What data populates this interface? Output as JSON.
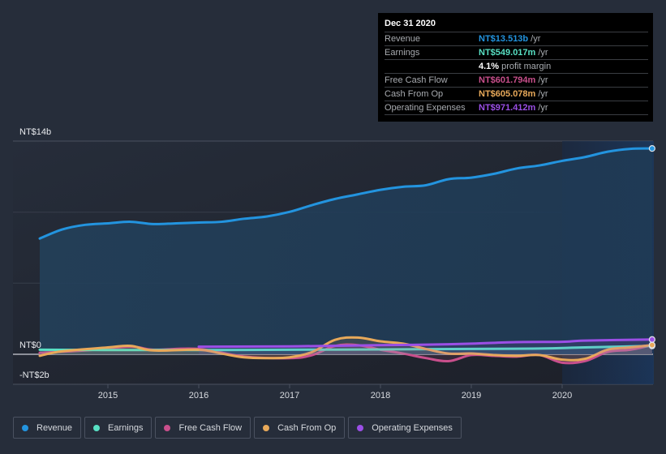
{
  "chart_data": {
    "type": "line",
    "title": "",
    "xlabel": "",
    "ylabel": "",
    "currency_prefix": "NT$",
    "y_ticks": [
      {
        "value": 14,
        "label": "NT$14b"
      },
      {
        "value": 0,
        "label": "NT$0"
      },
      {
        "value": -2,
        "label": "-NT$2b"
      }
    ],
    "ylim": [
      -2,
      14
    ],
    "xlim": [
      2014.25,
      2020.99
    ],
    "x_ticks": [
      {
        "value": 2015,
        "label": "2015"
      },
      {
        "value": 2016,
        "label": "2016"
      },
      {
        "value": 2017,
        "label": "2017"
      },
      {
        "value": 2018,
        "label": "2018"
      },
      {
        "value": 2019,
        "label": "2019"
      },
      {
        "value": 2020,
        "label": "2020"
      }
    ],
    "highlight_range": [
      2020.0,
      2020.99
    ],
    "units": "NT$ billions",
    "series": [
      {
        "name": "Revenue",
        "color": "#2394df",
        "filled": true,
        "x": [
          2014.25,
          2014.5,
          2014.75,
          2015.0,
          2015.25,
          2015.5,
          2015.75,
          2016.0,
          2016.25,
          2016.5,
          2016.75,
          2017.0,
          2017.25,
          2017.5,
          2017.75,
          2018.0,
          2018.25,
          2018.5,
          2018.75,
          2019.0,
          2019.25,
          2019.5,
          2019.75,
          2020.0,
          2020.25,
          2020.5,
          2020.75,
          2020.99
        ],
        "values": [
          7.6,
          8.2,
          8.5,
          8.6,
          8.7,
          8.55,
          8.6,
          8.65,
          8.7,
          8.9,
          9.05,
          9.35,
          9.8,
          10.2,
          10.5,
          10.8,
          11.0,
          11.1,
          11.5,
          11.6,
          11.85,
          12.2,
          12.4,
          12.7,
          12.95,
          13.3,
          13.49,
          13.513
        ]
      },
      {
        "name": "Earnings",
        "color": "#58e0c4",
        "x": [
          2014.25,
          2015.0,
          2016.0,
          2017.0,
          2018.0,
          2019.0,
          2019.75,
          2020.25,
          2020.99
        ],
        "values": [
          0.3,
          0.28,
          0.28,
          0.3,
          0.32,
          0.35,
          0.38,
          0.45,
          0.549
        ]
      },
      {
        "name": "Free Cash Flow",
        "color": "#c94f8c",
        "x": [
          2014.25,
          2014.75,
          2015.25,
          2015.5,
          2016.0,
          2016.5,
          2017.0,
          2017.25,
          2017.5,
          2017.75,
          2018.0,
          2018.25,
          2018.5,
          2018.75,
          2019.0,
          2019.25,
          2019.5,
          2019.75,
          2020.0,
          2020.25,
          2020.5,
          2020.75,
          2020.99
        ],
        "values": [
          0.1,
          0.25,
          0.5,
          0.3,
          0.35,
          -0.15,
          -0.25,
          -0.05,
          0.55,
          0.6,
          0.3,
          0.05,
          -0.25,
          -0.45,
          -0.05,
          -0.1,
          -0.15,
          -0.05,
          -0.55,
          -0.45,
          0.15,
          0.3,
          0.6018
        ]
      },
      {
        "name": "Cash From Op",
        "color": "#e8a95a",
        "x": [
          2014.25,
          2014.5,
          2015.0,
          2015.25,
          2015.5,
          2016.0,
          2016.25,
          2016.5,
          2016.75,
          2017.0,
          2017.25,
          2017.5,
          2017.75,
          2018.0,
          2018.25,
          2018.5,
          2018.75,
          2019.0,
          2019.25,
          2019.5,
          2019.75,
          2020.0,
          2020.25,
          2020.5,
          2020.75,
          2020.99
        ],
        "values": [
          -0.1,
          0.2,
          0.45,
          0.55,
          0.25,
          0.3,
          0.05,
          -0.2,
          -0.25,
          -0.2,
          0.15,
          0.95,
          1.1,
          0.85,
          0.7,
          0.35,
          0.05,
          0.05,
          -0.05,
          -0.1,
          -0.05,
          -0.35,
          -0.3,
          0.3,
          0.45,
          0.6051
        ]
      },
      {
        "name": "Operating Expenses",
        "color": "#9b4fe6",
        "x": [
          2016.0,
          2017.0,
          2018.0,
          2018.5,
          2019.0,
          2019.5,
          2020.0,
          2020.25,
          2020.99
        ],
        "values": [
          0.5,
          0.52,
          0.6,
          0.63,
          0.7,
          0.8,
          0.82,
          0.9,
          0.9714
        ]
      }
    ]
  },
  "tooltip": {
    "date": "Dec 31 2020",
    "rows": [
      {
        "label": "Revenue",
        "value": "NT$13.513b",
        "unit": "/yr",
        "color": "#2394df"
      },
      {
        "label": "Earnings",
        "value": "NT$549.017m",
        "unit": "/yr",
        "color": "#58e0c4"
      },
      {
        "label": "",
        "value": "4.1%",
        "unit": "profit margin",
        "color": "#ffffff"
      },
      {
        "label": "Free Cash Flow",
        "value": "NT$601.794m",
        "unit": "/yr",
        "color": "#c94f8c"
      },
      {
        "label": "Cash From Op",
        "value": "NT$605.078m",
        "unit": "/yr",
        "color": "#e8a95a"
      },
      {
        "label": "Operating Expenses",
        "value": "NT$971.412m",
        "unit": "/yr",
        "color": "#9b4fe6"
      }
    ]
  },
  "legend": [
    {
      "label": "Revenue",
      "color": "#2394df"
    },
    {
      "label": "Earnings",
      "color": "#58e0c4"
    },
    {
      "label": "Free Cash Flow",
      "color": "#c94f8c"
    },
    {
      "label": "Cash From Op",
      "color": "#e8a95a"
    },
    {
      "label": "Operating Expenses",
      "color": "#9b4fe6"
    }
  ]
}
